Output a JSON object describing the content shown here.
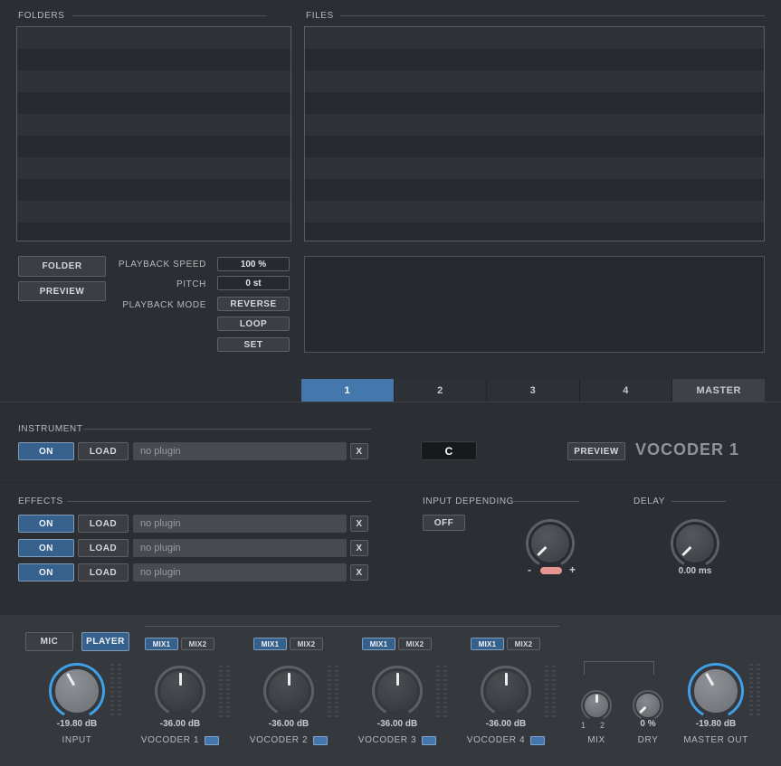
{
  "browser": {
    "folders_label": "FOLDERS",
    "files_label": "FILES",
    "folder_button": "FOLDER",
    "preview_button": "PREVIEW",
    "playback_speed_label": "PLAYBACK SPEED",
    "playback_speed_value": "100 %",
    "pitch_label": "PITCH",
    "pitch_value": "0 st",
    "playback_mode_label": "PLAYBACK  MODE",
    "reverse_button": "REVERSE",
    "loop_button": "LOOP",
    "set_button": "SET"
  },
  "tabs": {
    "items": [
      {
        "label": "1",
        "active": true
      },
      {
        "label": "2",
        "active": false
      },
      {
        "label": "3",
        "active": false
      },
      {
        "label": "4",
        "active": false
      },
      {
        "label": "MASTER",
        "active": false
      }
    ]
  },
  "instrument": {
    "section_label": "INSTRUMENT",
    "on_button": "ON",
    "load_button": "LOAD",
    "plugin_name": "no plugin",
    "clear_button": "X",
    "note_value": "C",
    "preview_button": "PREVIEW",
    "title": "VOCODER 1"
  },
  "effects": {
    "section_label": "EFFECTS",
    "rows": [
      {
        "on_button": "ON",
        "load_button": "LOAD",
        "plugin_name": "no plugin",
        "clear_button": "X"
      },
      {
        "on_button": "ON",
        "load_button": "LOAD",
        "plugin_name": "no plugin",
        "clear_button": "X"
      },
      {
        "on_button": "ON",
        "load_button": "LOAD",
        "plugin_name": "no plugin",
        "clear_button": "X"
      }
    ],
    "input_depending": {
      "section_label": "INPUT DEPENDING",
      "off_button": "OFF",
      "minus_label": "-",
      "plus_label": "+"
    },
    "delay": {
      "section_label": "DELAY",
      "value": "0.00 ms"
    }
  },
  "mixer": {
    "mic_button": "MIC",
    "player_button": "PLAYER",
    "input": {
      "value": "-19.80 dB",
      "label": "INPUT"
    },
    "vocoders": [
      {
        "mix1_button": "MIX1",
        "mix2_button": "MIX2",
        "value": "-36.00 dB",
        "label": "VOCODER 1"
      },
      {
        "mix1_button": "MIX1",
        "mix2_button": "MIX2",
        "value": "-36.00 dB",
        "label": "VOCODER 2"
      },
      {
        "mix1_button": "MIX1",
        "mix2_button": "MIX2",
        "value": "-36.00 dB",
        "label": "VOCODER 3"
      },
      {
        "mix1_button": "MIX1",
        "mix2_button": "MIX2",
        "value": "-36.00 dB",
        "label": "VOCODER 4"
      }
    ],
    "mix": {
      "label": "MIX",
      "ch1": "1",
      "ch2": "2"
    },
    "dry": {
      "value": "0 %",
      "label": "DRY"
    },
    "master": {
      "value": "-19.80 dB",
      "label": "MASTER OUT"
    }
  },
  "colors": {
    "accent_blue": "#4478ad",
    "knob_arc_blue": "#3fa0e8",
    "slider_pink": "#e89490",
    "background": "#2b2e32",
    "mixer_background": "#35383c"
  }
}
